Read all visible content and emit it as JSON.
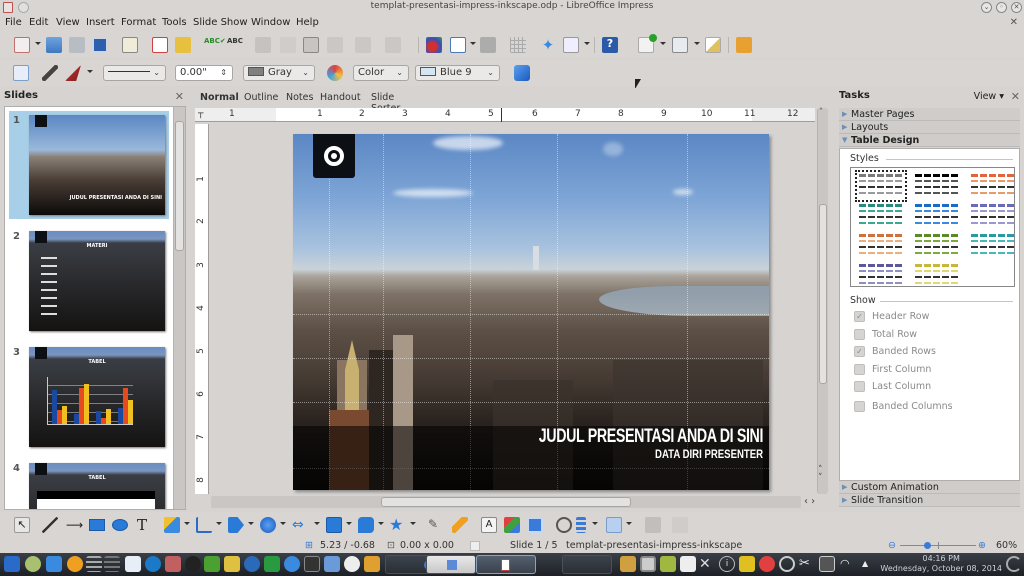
{
  "window": {
    "title": "templat-presentasi-impress-inkscape.odp - LibreOffice Impress",
    "buttons": [
      "minimize",
      "maximize",
      "close"
    ]
  },
  "menu": [
    "File",
    "Edit",
    "View",
    "Insert",
    "Format",
    "Tools",
    "Slide Show",
    "Window",
    "Help"
  ],
  "standard_toolbar": {
    "icons": [
      "new-icon",
      "open-icon",
      "save-icon",
      "save-as-icon",
      "edit-file-icon",
      "export-pdf-icon",
      "print-icon",
      "spellcheck-icon",
      "autospell-icon",
      "cut-icon",
      "copy-icon",
      "paste-icon",
      "clone-format-icon",
      "undo-icon",
      "redo-icon",
      "chart-icon",
      "table-icon",
      "insert-object-icon",
      "grid-icon",
      "helplines-icon",
      "slide-layout-icon",
      "help-icon",
      "new-slide-icon",
      "slide-design-icon",
      "master-slide-icon",
      "present-icon"
    ]
  },
  "line_fill_toolbar": {
    "line_style": "",
    "line_width": "0.00\"",
    "line_color": {
      "label": "Gray",
      "hex": "#808080"
    },
    "area_style": "Color",
    "fill_color": {
      "label": "Blue 9",
      "hex": "#d4e6f4"
    }
  },
  "slides_pane": {
    "title": "Slides",
    "slides": [
      {
        "number": "1",
        "label": "JUDUL PRESENTASI ANDA DI SINI",
        "selected": true
      },
      {
        "number": "2",
        "label": "MATERI",
        "selected": false
      },
      {
        "number": "3",
        "label": "TABEL",
        "selected": false
      },
      {
        "number": "4",
        "label": "TABEL",
        "selected": false
      }
    ]
  },
  "view_tabs": [
    "Normal",
    "Outline",
    "Notes",
    "Handout",
    "Slide Sorter"
  ],
  "active_view": "Normal",
  "ruler": {
    "horizontal": [
      "1",
      "1",
      "2",
      "3",
      "4",
      "5",
      "6",
      "7",
      "8",
      "9",
      "10",
      "11",
      "12"
    ],
    "vertical": [
      "1",
      "2",
      "3",
      "4",
      "5",
      "6",
      "7",
      "8"
    ]
  },
  "slide": {
    "title": "JUDUL PRESENTASI ANDA DI SINI",
    "subtitle": "DATA DIRI PRESENTER"
  },
  "tasks_pane": {
    "title": "Tasks",
    "view_menu": "View",
    "sections": [
      {
        "label": "Master Pages",
        "expanded": false
      },
      {
        "label": "Layouts",
        "expanded": false
      },
      {
        "label": "Table Design",
        "expanded": true
      }
    ],
    "styles_label": "Styles",
    "table_styles": [
      {
        "name": "default",
        "header": "#7a7a7a",
        "body": "#9a9a9a",
        "selected": true
      },
      {
        "name": "black",
        "header": "#000000",
        "body": "#555555",
        "selected": false
      },
      {
        "name": "orange",
        "header": "#e0643c",
        "body": "#e89a6a",
        "selected": false
      },
      {
        "name": "teal",
        "header": "#2a8c7c",
        "body": "#3aa892",
        "selected": false
      },
      {
        "name": "blue",
        "header": "#1a6ac8",
        "body": "#3a8ae0",
        "selected": false
      },
      {
        "name": "lavender",
        "header": "#6a6ab8",
        "body": "#9a9ad0",
        "selected": false
      },
      {
        "name": "peach",
        "header": "#d0703c",
        "body": "#e8b080",
        "selected": false
      },
      {
        "name": "olive",
        "header": "#5a8a2a",
        "body": "#80a840",
        "selected": false
      },
      {
        "name": "cyan",
        "header": "#2a9aa0",
        "body": "#4ab8b8",
        "selected": false
      },
      {
        "name": "slate",
        "header": "#5a5a9a",
        "body": "#9090c0",
        "selected": false
      },
      {
        "name": "yellow",
        "header": "#c8b83a",
        "body": "#e0d870",
        "selected": false
      }
    ],
    "show_label": "Show",
    "show_options": [
      {
        "label": "Header Row",
        "checked": true
      },
      {
        "label": "Total Row",
        "checked": false
      },
      {
        "label": "Banded Rows",
        "checked": true
      },
      {
        "label": "First Column",
        "checked": false
      },
      {
        "label": "Last Column",
        "checked": false
      },
      {
        "label": "Banded Columns",
        "checked": false
      }
    ],
    "bottom_sections": [
      {
        "label": "Custom Animation",
        "expanded": false
      },
      {
        "label": "Slide Transition",
        "expanded": false
      }
    ]
  },
  "drawing_toolbar": {
    "icons": [
      "select-icon",
      "line-icon",
      "arrow-line-icon",
      "rectangle-icon",
      "ellipse-icon",
      "text-icon",
      "curve-icon",
      "connector-icon",
      "basic-shapes-icon",
      "symbol-shapes-icon",
      "block-arrows-icon",
      "flowchart-icon",
      "callouts-icon",
      "stars-icon",
      "points-icon",
      "glue-points-icon",
      "fontwork-icon",
      "from-file-icon",
      "gallery-icon",
      "rotate-icon",
      "align-icon",
      "arrange-icon",
      "extrusion-icon",
      "toggle-3d-icon"
    ]
  },
  "status": {
    "position": "5.23 / -0.68",
    "size": "0.00 x 0.00",
    "slide": "Slide 1 / 5",
    "master": "templat-presentasi-impress-inkscape",
    "zoom": "60%",
    "zoom_fraction": 0.35
  },
  "taskbar": {
    "time": "04:16 PM",
    "date": "Wednesday, October 08, 2014"
  }
}
